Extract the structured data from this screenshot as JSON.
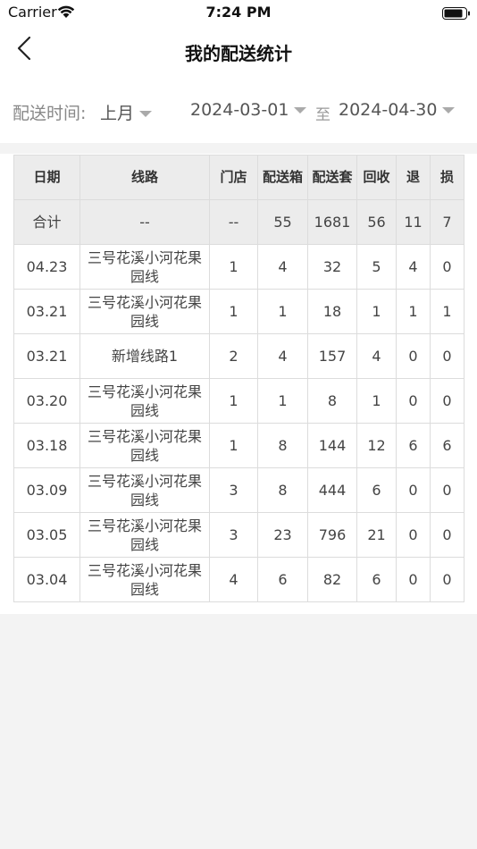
{
  "status_bar": {
    "carrier": "Carrier",
    "time": "7:24 PM"
  },
  "nav": {
    "title": "我的配送统计"
  },
  "filter": {
    "label": "配送时间:",
    "period": "上月",
    "start_date": "2024-03-01",
    "to_label": "至",
    "end_date": "2024-04-30"
  },
  "table": {
    "headers": [
      "日期",
      "线路",
      "门店",
      "配送箱",
      "配送套",
      "回收",
      "退",
      "损"
    ],
    "total": {
      "date": "合计",
      "route": "--",
      "stores": "--",
      "boxes": "55",
      "sets": "1681",
      "recycled": "56",
      "returned": "11",
      "damaged": "7"
    },
    "rows": [
      {
        "date": "04.23",
        "route": "三号花溪小河花果园线",
        "stores": "1",
        "boxes": "4",
        "sets": "32",
        "recycled": "5",
        "returned": "4",
        "damaged": "0"
      },
      {
        "date": "03.21",
        "route": "三号花溪小河花果园线",
        "stores": "1",
        "boxes": "1",
        "sets": "18",
        "recycled": "1",
        "returned": "1",
        "damaged": "1"
      },
      {
        "date": "03.21",
        "route": "新增线路1",
        "stores": "2",
        "boxes": "4",
        "sets": "157",
        "recycled": "4",
        "returned": "0",
        "damaged": "0"
      },
      {
        "date": "03.20",
        "route": "三号花溪小河花果园线",
        "stores": "1",
        "boxes": "1",
        "sets": "8",
        "recycled": "1",
        "returned": "0",
        "damaged": "0"
      },
      {
        "date": "03.18",
        "route": "三号花溪小河花果园线",
        "stores": "1",
        "boxes": "8",
        "sets": "144",
        "recycled": "12",
        "returned": "6",
        "damaged": "6"
      },
      {
        "date": "03.09",
        "route": "三号花溪小河花果园线",
        "stores": "3",
        "boxes": "8",
        "sets": "444",
        "recycled": "6",
        "returned": "0",
        "damaged": "0"
      },
      {
        "date": "03.05",
        "route": "三号花溪小河花果园线",
        "stores": "3",
        "boxes": "23",
        "sets": "796",
        "recycled": "21",
        "returned": "0",
        "damaged": "0"
      },
      {
        "date": "03.04",
        "route": "三号花溪小河花果园线",
        "stores": "4",
        "boxes": "6",
        "sets": "82",
        "recycled": "6",
        "returned": "0",
        "damaged": "0"
      }
    ]
  }
}
